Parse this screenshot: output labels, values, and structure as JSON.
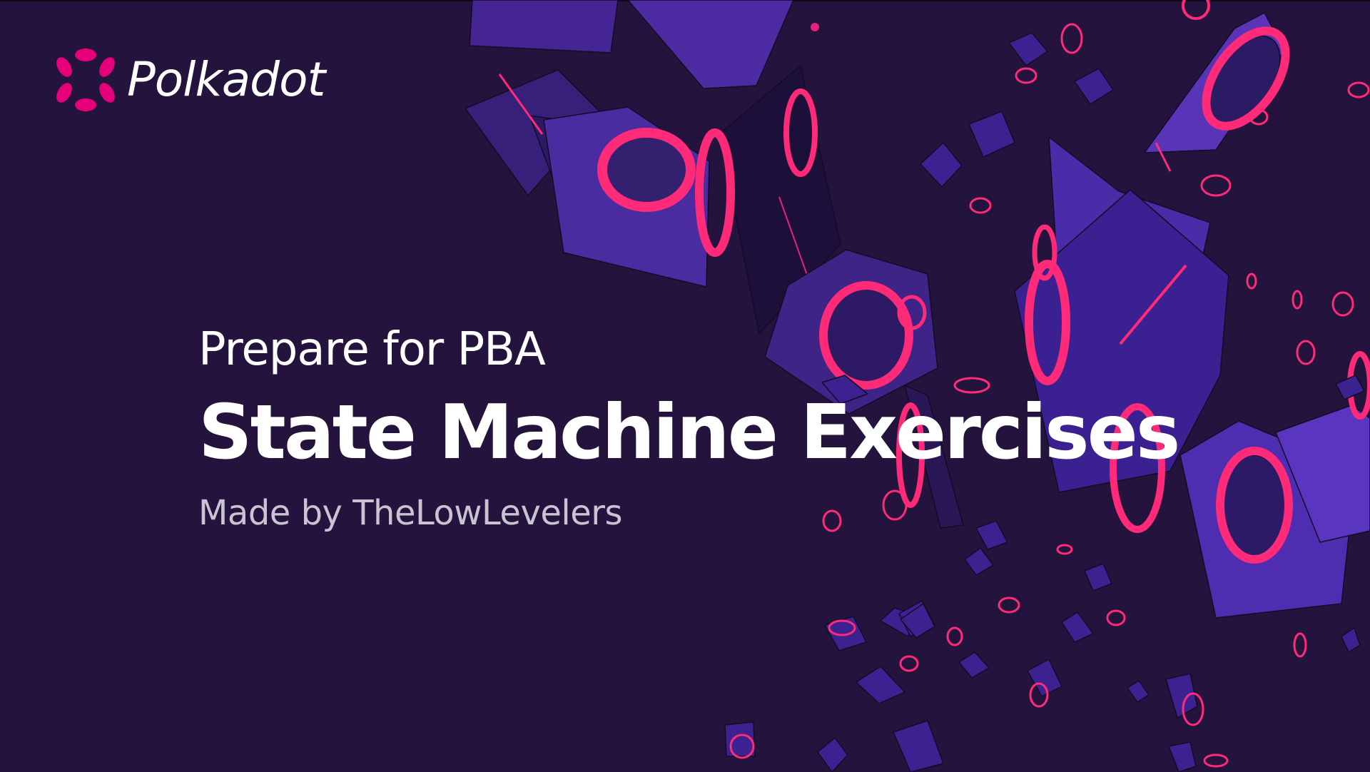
{
  "slide": {
    "brand": {
      "name": "Polkadot",
      "logo_icon": "polkadot-dots-icon",
      "accent_color": "#e6007a"
    },
    "subtitle": "Prepare for PBA",
    "title": "State Machine Exercises",
    "byline": "Made by TheLowLevelers",
    "background_color": "#24133d",
    "illustration": "graduation-caps"
  }
}
